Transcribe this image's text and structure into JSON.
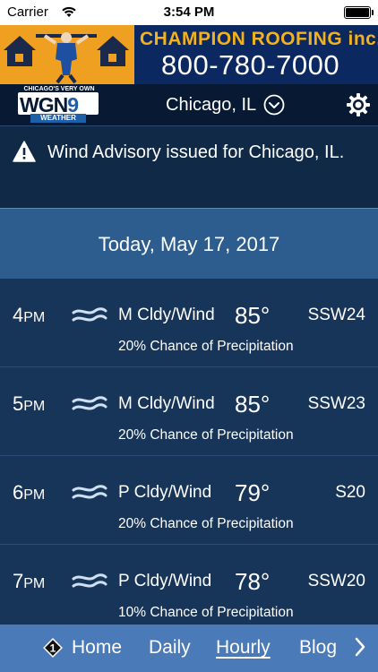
{
  "status_bar": {
    "carrier": "Carrier",
    "time": "3:54 PM"
  },
  "ad": {
    "company": "CHAMPION ROOFING inc.",
    "phone": "800-780-7000"
  },
  "header": {
    "logo": {
      "tagline": "CHICAGO'S VERY OWN",
      "main": "WGN",
      "channel": "9",
      "sub": "WEATHER"
    },
    "location": "Chicago, IL"
  },
  "alert": {
    "text": "Wind Advisory issued for Chicago, IL."
  },
  "date": "Today, May 17, 2017",
  "hours": [
    {
      "hour": "4",
      "ampm": "PM",
      "condition": "M Cldy/Wind",
      "temp": "85°",
      "wind": "SSW24",
      "precip": "20% Chance of Precipitation"
    },
    {
      "hour": "5",
      "ampm": "PM",
      "condition": "M Cldy/Wind",
      "temp": "85°",
      "wind": "SSW23",
      "precip": "20% Chance of Precipitation"
    },
    {
      "hour": "6",
      "ampm": "PM",
      "condition": "P Cldy/Wind",
      "temp": "79°",
      "wind": "S20",
      "precip": "20% Chance of Precipitation"
    },
    {
      "hour": "7",
      "ampm": "PM",
      "condition": "P Cldy/Wind",
      "temp": "78°",
      "wind": "SSW20",
      "precip": "10% Chance of Precipitation"
    }
  ],
  "bottom_nav": {
    "badge": "1",
    "items": [
      "Home",
      "Daily",
      "Hourly",
      "Blog"
    ],
    "active": "Hourly"
  },
  "icons": {
    "wifi": "wifi-icon",
    "battery": "battery-icon",
    "chevron": "chevron-down-circle-icon",
    "settings": "gear-icon",
    "alert": "warning-icon",
    "condition": "wind-icon",
    "next": "chevron-right-icon"
  }
}
